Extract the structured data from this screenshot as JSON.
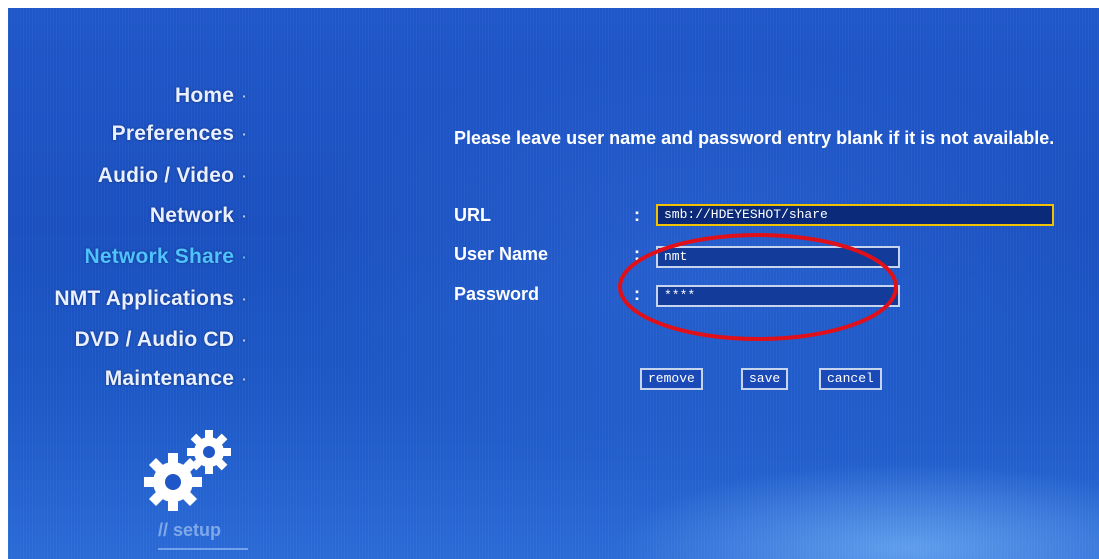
{
  "menu": {
    "items": [
      {
        "label": "Home",
        "active": false
      },
      {
        "label": "Preferences",
        "active": false
      },
      {
        "label": "Audio / Video",
        "active": false
      },
      {
        "label": "Network",
        "active": false
      },
      {
        "label": "Network Share",
        "active": true
      },
      {
        "label": "NMT Applications",
        "active": false
      },
      {
        "label": "DVD / Audio CD",
        "active": false
      },
      {
        "label": "Maintenance",
        "active": false
      }
    ],
    "bullet": "·",
    "active_color": "#4fc3ff"
  },
  "setup": {
    "icon": "gears-icon",
    "label": "// setup"
  },
  "form": {
    "notice": "Please leave user name and password entry blank if it is not available.",
    "colon": ":",
    "url_label": "URL",
    "url_value": "smb://HDEYESHOT/share",
    "username_label": "User Name",
    "username_value": "nmt",
    "password_label": "Password",
    "password_value": "****"
  },
  "buttons": {
    "remove": "remove",
    "save": "save",
    "cancel": "cancel"
  },
  "annotation": {
    "color": "#e0101a"
  }
}
